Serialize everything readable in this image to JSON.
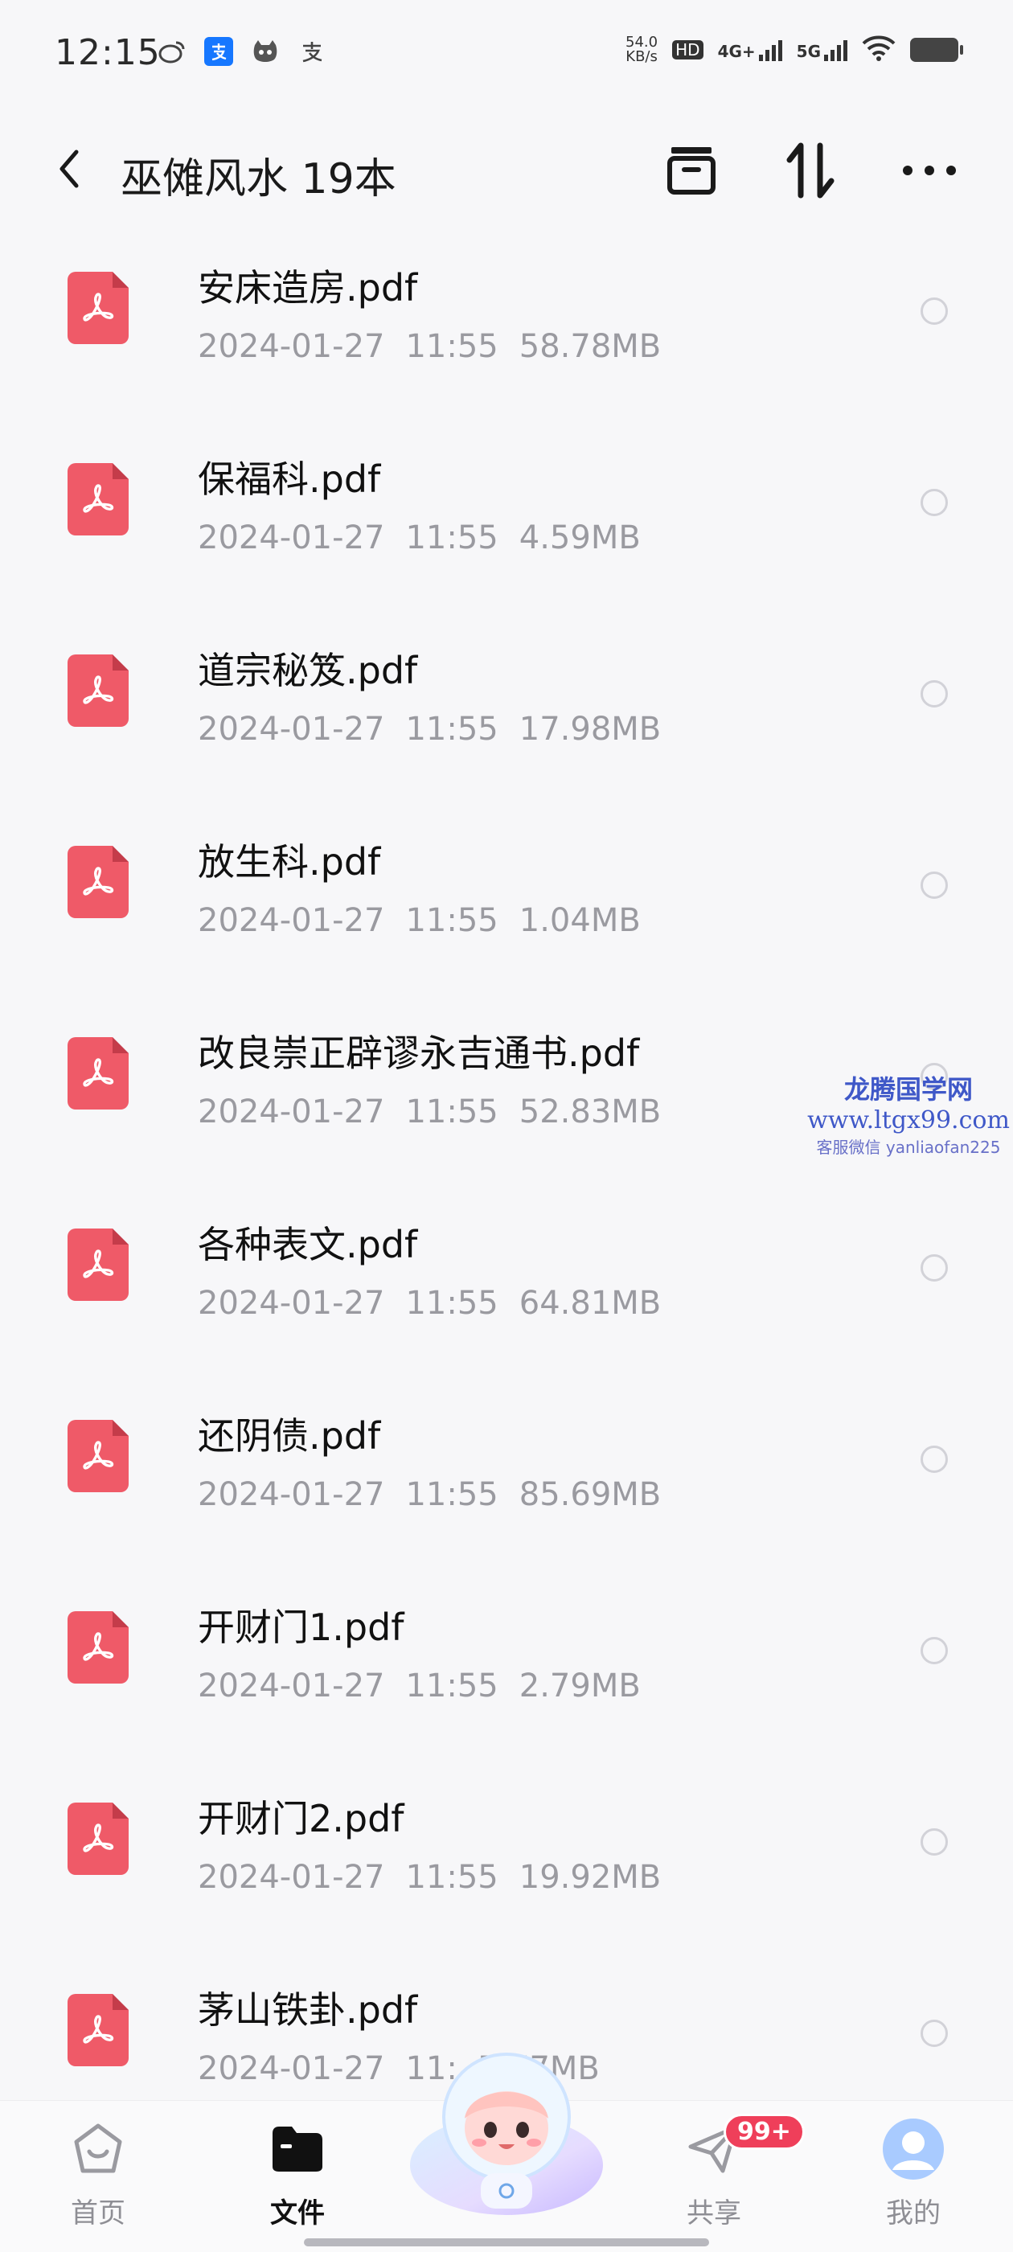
{
  "status_bar": {
    "time": "12:15",
    "net_speed_value": "54.0",
    "net_speed_unit": "KB/s",
    "hd": "HD",
    "network_4g": "4G+",
    "network_5g": "5G",
    "app_icons": [
      "weibo-icon",
      "alipay-icon",
      "app-cat-icon",
      "alipay-outline-icon"
    ]
  },
  "header": {
    "title": "巫傩风水 19本",
    "icons": [
      "back-arrow-icon",
      "archive-icon",
      "sort-icon",
      "more-icon"
    ]
  },
  "files": [
    {
      "name": "安床造房.pdf",
      "date": "2024-01-27",
      "time": "11:55",
      "size": "58.78MB"
    },
    {
      "name": "保福科.pdf",
      "date": "2024-01-27",
      "time": "11:55",
      "size": "4.59MB"
    },
    {
      "name": "道宗秘笈.pdf",
      "date": "2024-01-27",
      "time": "11:55",
      "size": "17.98MB"
    },
    {
      "name": "放生科.pdf",
      "date": "2024-01-27",
      "time": "11:55",
      "size": "1.04MB"
    },
    {
      "name": "改良崇正辟谬永吉通书.pdf",
      "date": "2024-01-27",
      "time": "11:55",
      "size": "52.83MB"
    },
    {
      "name": "各种表文.pdf",
      "date": "2024-01-27",
      "time": "11:55",
      "size": "64.81MB"
    },
    {
      "name": "还阴债.pdf",
      "date": "2024-01-27",
      "time": "11:55",
      "size": "85.69MB"
    },
    {
      "name": "开财门1.pdf",
      "date": "2024-01-27",
      "time": "11:55",
      "size": "2.79MB"
    },
    {
      "name": "开财门2.pdf",
      "date": "2024-01-27",
      "time": "11:55",
      "size": "19.92MB"
    },
    {
      "name": "茅山铁卦.pdf",
      "date": "2024-01-27",
      "time": "11:",
      "size": "7.77MB"
    }
  ],
  "watermark": {
    "line1": "龙腾国学网",
    "line2": "www.ltgx99.com",
    "line3": "客服微信 yanliaofan225"
  },
  "bottom_nav": {
    "items": [
      {
        "label": "首页",
        "icon": "home-icon"
      },
      {
        "label": "文件",
        "icon": "folder-icon"
      },
      {
        "label": "",
        "icon": "mascot-icon"
      },
      {
        "label": "共享",
        "icon": "share-send-icon"
      },
      {
        "label": "我的",
        "icon": "profile-icon"
      }
    ],
    "share_badge": "99+"
  },
  "colors": {
    "pdf_icon": "#ef5a68",
    "badge": "#ef3f5a",
    "meta_text": "#9a9aa0",
    "background": "#f7f7f9"
  }
}
